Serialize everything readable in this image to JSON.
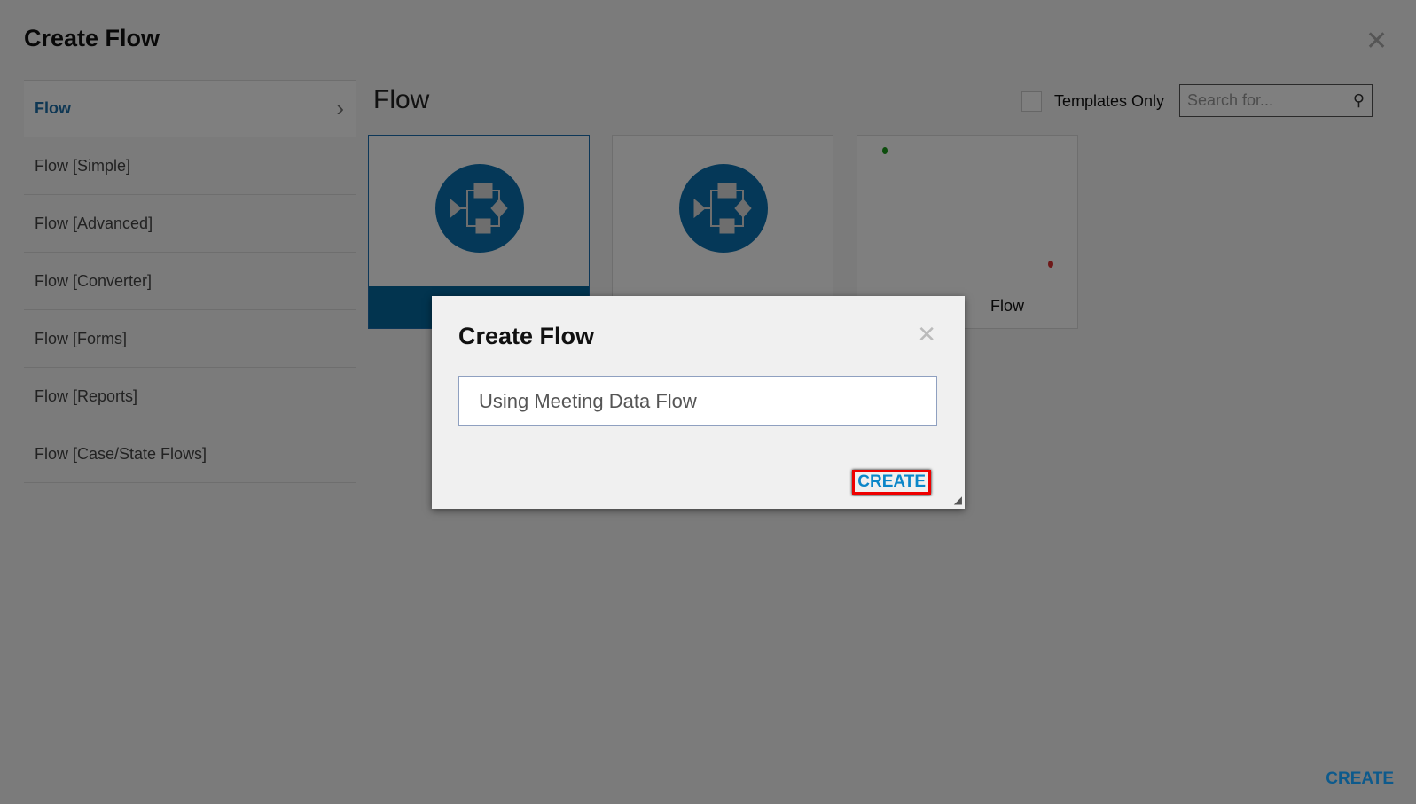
{
  "header": {
    "title": "Create Flow"
  },
  "sidebar": {
    "items": [
      {
        "label": "Flow",
        "selected": true
      },
      {
        "label": "Flow [Simple]"
      },
      {
        "label": "Flow [Advanced]"
      },
      {
        "label": "Flow [Converter]"
      },
      {
        "label": "Flow [Forms]"
      },
      {
        "label": "Flow [Reports]"
      },
      {
        "label": "Flow [Case/State Flows]"
      }
    ]
  },
  "main": {
    "heading": "Flow",
    "templates_only_label": "Templates Only",
    "templates_only_checked": false,
    "search_placeholder": "Search for...",
    "cards": [
      {
        "icon": "flow-diagram-icon",
        "selected": true
      },
      {
        "icon": "flow-diagram-icon"
      },
      {
        "label_partial": "Flow"
      }
    ],
    "create_label": "CREATE"
  },
  "dialog": {
    "title": "Create Flow",
    "name_value": "Using Meeting Data Flow",
    "create_label": "CREATE"
  },
  "colors": {
    "accent": "#0a71b0",
    "highlight": "#e00000"
  }
}
